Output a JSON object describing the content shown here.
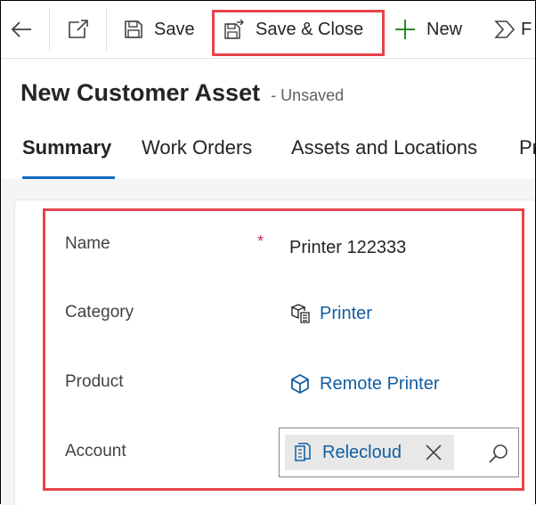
{
  "toolbar": {
    "save_label": "Save",
    "save_close_label": "Save & Close",
    "new_label": "New",
    "flow_label": "F"
  },
  "record": {
    "title": "New Customer Asset",
    "status": "- Unsaved"
  },
  "tabs": [
    {
      "label": "Summary",
      "active": true
    },
    {
      "label": "Work Orders",
      "active": false
    },
    {
      "label": "Assets and Locations",
      "active": false
    },
    {
      "label": "Pr",
      "active": false
    }
  ],
  "form": {
    "name_label": "Name",
    "name_required_marker": "*",
    "name_value": "Printer 122333",
    "category_label": "Category",
    "category_value": "Printer",
    "product_label": "Product",
    "product_value": "Remote Printer",
    "account_label": "Account",
    "account_value": "Relecloud"
  },
  "colors": {
    "accent": "#0f6cbd",
    "link": "#115ea3",
    "highlight": "#e8434a",
    "required": "#c4314b"
  },
  "icons": [
    "back-arrow-icon",
    "pop-out-icon",
    "save-icon",
    "save-close-icon",
    "plus-icon",
    "flow-icon",
    "category-icon",
    "product-box-icon",
    "account-icon",
    "close-icon",
    "search-icon"
  ]
}
